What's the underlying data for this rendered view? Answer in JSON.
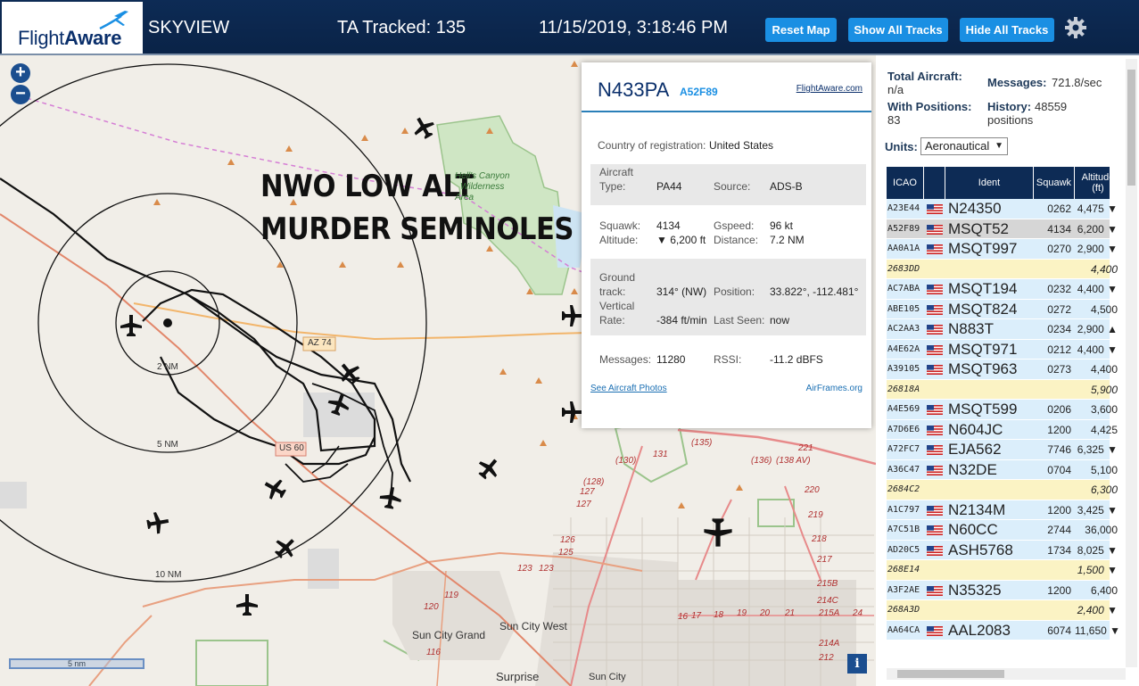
{
  "header": {
    "logo_text_light": "Flight",
    "logo_text_bold": "Aware",
    "app_name": "SKYVIEW",
    "ta_tracked": "TA Tracked: 135",
    "datetime": "11/15/2019, 3:18:46 PM",
    "buttons": {
      "reset_map": "Reset Map",
      "show_all": "Show All Tracks",
      "hide_all": "Hide All Tracks"
    }
  },
  "map": {
    "zoom_in": "+",
    "zoom_out": "−",
    "overlay_line1": "NWO LOW ALT",
    "overlay_line2": "MURDER SEMINOLES",
    "labels": {
      "wilderness1": "Hell's Canyon",
      "wilderness2": "Wilderness",
      "wilderness3": "Area",
      "az74": "AZ 74",
      "us60": "US 60",
      "ring2": "2 NM",
      "ring5": "5 NM",
      "ring10": "10 NM",
      "sun_city_grand": "Sun City Grand",
      "sun_city_west": "Sun City West",
      "surprise": "Surprise",
      "sun_city": "Sun City"
    },
    "scale_label": "5 nm",
    "info_button": "i"
  },
  "popup": {
    "callsign": "N433PA",
    "hex": "A52F89",
    "fa_link": "FlightAware.com",
    "country_label": "Country of registration:",
    "country_value": "United States",
    "aircraft_type_label1": "Aircraft",
    "aircraft_type_label2": "Type:",
    "aircraft_type_value": "PA44",
    "source_label": "Source:",
    "source_value": "ADS-B",
    "squawk_label": "Squawk:",
    "squawk_value": "4134",
    "gspeed_label": "Gspeed:",
    "gspeed_value": "96 kt",
    "altitude_label": "Altitude:",
    "altitude_value": "▼ 6,200 ft",
    "distance_label": "Distance:",
    "distance_value": "7.2 NM",
    "ground_label1": "Ground",
    "ground_label2": "track:",
    "ground_value": "314° (NW)",
    "position_label": "Position:",
    "position_value": "33.822°, -112.481°",
    "vrate_label1": "Vertical",
    "vrate_label2": "Rate:",
    "vrate_value": "-384 ft/min",
    "lastseen_label": "Last Seen:",
    "lastseen_value": "now",
    "messages_label": "Messages:",
    "messages_value": "11280",
    "rssi_label": "RSSI:",
    "rssi_value": "-11.2 dBFS",
    "photos_link": "See Aircraft Photos",
    "airframes_link": "AirFrames.org"
  },
  "panel": {
    "total_label": "Total Aircraft:",
    "total_value": "n/a",
    "messages_label": "Messages:",
    "messages_value": "721.8/sec",
    "withpos_label": "With Positions:",
    "withpos_value": "83",
    "history_label": "History:",
    "history_value": "48559",
    "history_suffix": "positions",
    "units_label": "Units:",
    "units_value": "Aeronautical",
    "columns": {
      "icao": "ICAO",
      "ident": "Ident",
      "squawk": "Squawk",
      "alt1": "Altitude",
      "alt2": "(ft)"
    },
    "colors": {
      "row_blue": "#dbeefb",
      "row_yellow": "#fbf3c4",
      "row_selected": "#d6d6d6",
      "header": "#0d2b55"
    },
    "rows": [
      {
        "icao": "A23E44",
        "ident": "N24350",
        "squawk": "0262",
        "alt": "4,475 ▼",
        "flag": true,
        "style": "blue"
      },
      {
        "icao": "A52F89",
        "ident": "MSQT52",
        "squawk": "4134",
        "alt": "6,200 ▼",
        "flag": true,
        "style": "selected"
      },
      {
        "icao": "AA0A1A",
        "ident": "MSQT997",
        "squawk": "0270",
        "alt": "2,900 ▼",
        "flag": true,
        "style": "blue"
      },
      {
        "icao": "2683DD",
        "ident": "",
        "squawk": "",
        "alt": "4,400",
        "flag": false,
        "style": "yellow"
      },
      {
        "icao": "AC7ABA",
        "ident": "MSQT194",
        "squawk": "0232",
        "alt": "4,400 ▼",
        "flag": true,
        "style": "blue"
      },
      {
        "icao": "ABE105",
        "ident": "MSQT824",
        "squawk": "0272",
        "alt": "4,500",
        "flag": true,
        "style": "blue"
      },
      {
        "icao": "AC2AA3",
        "ident": "N883T",
        "squawk": "0234",
        "alt": "2,900 ▲",
        "flag": true,
        "style": "blue"
      },
      {
        "icao": "A4E62A",
        "ident": "MSQT971",
        "squawk": "0212",
        "alt": "4,400 ▼",
        "flag": true,
        "style": "blue"
      },
      {
        "icao": "A39105",
        "ident": "MSQT963",
        "squawk": "0273",
        "alt": "4,400",
        "flag": true,
        "style": "blue"
      },
      {
        "icao": "26818A",
        "ident": "",
        "squawk": "",
        "alt": "5,900",
        "flag": false,
        "style": "yellow"
      },
      {
        "icao": "A4E569",
        "ident": "MSQT599",
        "squawk": "0206",
        "alt": "3,600",
        "flag": true,
        "style": "blue"
      },
      {
        "icao": "A7D6E6",
        "ident": "N604JC",
        "squawk": "1200",
        "alt": "4,425",
        "flag": true,
        "style": "blue"
      },
      {
        "icao": "A72FC7",
        "ident": "EJA562",
        "squawk": "7746",
        "alt": "6,325 ▼",
        "flag": true,
        "style": "blue"
      },
      {
        "icao": "A36C47",
        "ident": "N32DE",
        "squawk": "0704",
        "alt": "5,100",
        "flag": true,
        "style": "blue"
      },
      {
        "icao": "2684C2",
        "ident": "",
        "squawk": "",
        "alt": "6,300",
        "flag": false,
        "style": "yellow"
      },
      {
        "icao": "A1C797",
        "ident": "N2134M",
        "squawk": "1200",
        "alt": "3,425 ▼",
        "flag": true,
        "style": "blue"
      },
      {
        "icao": "A7C51B",
        "ident": "N60CC",
        "squawk": "2744",
        "alt": "36,000",
        "flag": true,
        "style": "blue"
      },
      {
        "icao": "AD20C5",
        "ident": "ASH5768",
        "squawk": "1734",
        "alt": "8,025 ▼",
        "flag": true,
        "style": "blue"
      },
      {
        "icao": "268E14",
        "ident": "",
        "squawk": "",
        "alt": "1,500 ▼",
        "flag": false,
        "style": "yellow"
      },
      {
        "icao": "A3F2AE",
        "ident": "N35325",
        "squawk": "1200",
        "alt": "6,400",
        "flag": true,
        "style": "blue"
      },
      {
        "icao": "268A3D",
        "ident": "",
        "squawk": "",
        "alt": "2,400 ▼",
        "flag": false,
        "style": "yellow"
      },
      {
        "icao": "AA64CA",
        "ident": "AAL2083",
        "squawk": "6074",
        "alt": "11,650 ▼",
        "flag": true,
        "style": "blue"
      }
    ]
  }
}
